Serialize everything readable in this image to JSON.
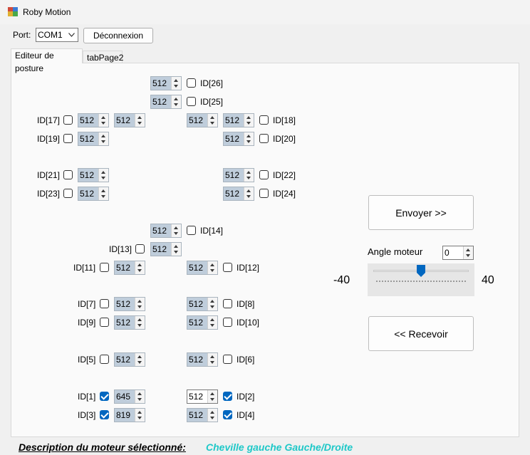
{
  "window": {
    "title": "Roby Motion"
  },
  "toolbar": {
    "port_label": "Port:",
    "port_value": "COM1",
    "disconnect_label": "Déconnexion"
  },
  "tabs": [
    {
      "label": "Editeur de posture",
      "active": true
    },
    {
      "label": "tabPage2",
      "active": false
    }
  ],
  "motors": [
    {
      "id": "ID[26]",
      "value": "512",
      "checked": false
    },
    {
      "id": "ID[25]",
      "value": "512",
      "checked": false
    },
    {
      "id": "ID[17]",
      "value": "512",
      "checked": false
    },
    {
      "id": "ID[18]",
      "value": "512",
      "checked": false
    },
    {
      "id": "ID[19]",
      "value": "512",
      "checked": false
    },
    {
      "id": "ID[20]",
      "value": "512",
      "checked": false
    },
    {
      "id": "ID[21]",
      "value": "512",
      "checked": false
    },
    {
      "id": "ID[22]",
      "value": "512",
      "checked": false
    },
    {
      "id": "ID[23]",
      "value": "512",
      "checked": false
    },
    {
      "id": "ID[24]",
      "value": "512",
      "checked": false
    },
    {
      "id": "ID[14]",
      "value": "512",
      "checked": false
    },
    {
      "id": "ID[13]",
      "value": "512",
      "checked": false
    },
    {
      "id": "ID[11]",
      "value": "512",
      "checked": false
    },
    {
      "id": "ID[12]",
      "value": "512",
      "checked": false
    },
    {
      "id": "ID[7]",
      "value": "512",
      "checked": false
    },
    {
      "id": "ID[8]",
      "value": "512",
      "checked": false
    },
    {
      "id": "ID[9]",
      "value": "512",
      "checked": false
    },
    {
      "id": "ID[10]",
      "value": "512",
      "checked": false
    },
    {
      "id": "ID[5]",
      "value": "512",
      "checked": false
    },
    {
      "id": "ID[6]",
      "value": "512",
      "checked": false
    },
    {
      "id": "ID[1]",
      "value": "645",
      "checked": true
    },
    {
      "id": "ID[2]",
      "value": "512",
      "checked": true
    },
    {
      "id": "ID[3]",
      "value": "819",
      "checked": true
    },
    {
      "id": "ID[4]",
      "value": "512",
      "checked": true
    }
  ],
  "extra_spinner_values": [
    "512",
    "512"
  ],
  "controls": {
    "send_label": "Envoyer >>",
    "receive_label": "<< Recevoir",
    "angle_label": "Angle moteur",
    "angle_value": "0",
    "slider_min": "-40",
    "slider_max": "40",
    "slider_value": 0
  },
  "description": {
    "label": "Description du moteur sélectionné:",
    "value": "Cheville gauche Gauche/Droite"
  }
}
